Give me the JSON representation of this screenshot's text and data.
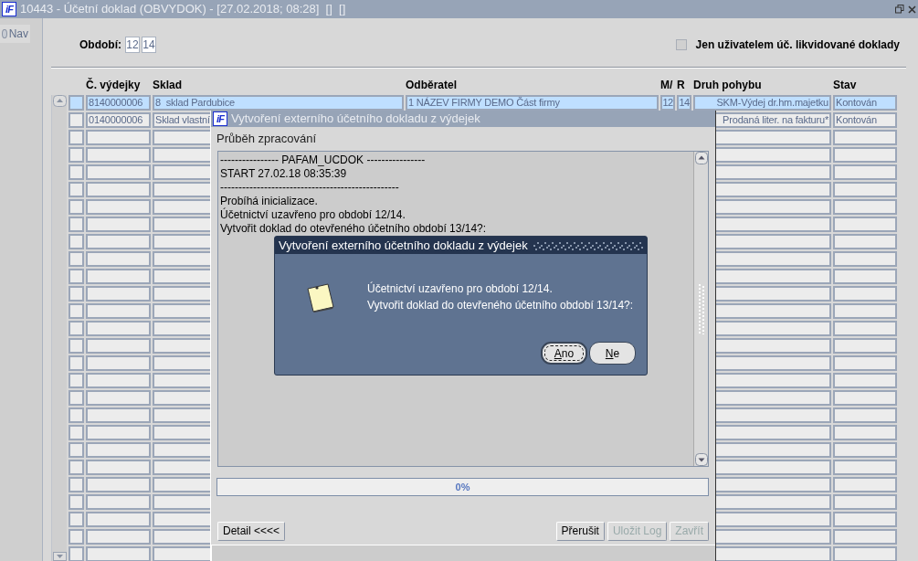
{
  "window": {
    "logo": "iF",
    "title": "10443 - Účetní doklad (OBVYDOK) - [27.02.2018; 08:28]  []  []"
  },
  "nav": {
    "label": "Nav",
    "selected": false
  },
  "filter": {
    "period_label": "Období:",
    "month": "12",
    "year": "14",
    "only_mine": {
      "label": "Jen uživatelem úč. likvidované doklady",
      "checked": false
    }
  },
  "table": {
    "columns": [
      "Č. výdejky",
      "Sklad",
      "Odběratel",
      "M/",
      "R",
      "Druh pohybu",
      "Stav"
    ],
    "rows": [
      {
        "selected": true,
        "cells": [
          "8140000006",
          "8  sklad Pardubice",
          "1 NÁZEV FIRMY DEMO Část firmy",
          "12",
          "14",
          "SKM-Výdej dr.hm.majetku",
          "Kontován"
        ]
      },
      {
        "selected": false,
        "cells": [
          "0140000006",
          "Sklad vlastní",
          null,
          null,
          null,
          "Prodaná liter. na fakturu*",
          "Kontován"
        ]
      }
    ]
  },
  "progress_window": {
    "logo": "iF",
    "title": "Vytvoření externího účetního dokladu z výdejek",
    "active": false,
    "section_label": "Průběh zpracování",
    "log": [
      "---------------- PAFAM_UCDOK ----------------",
      "START 27.02.18 08:35:39",
      "-------------------------------------------------",
      "Probíhá inicializace.",
      "Účetnictví uzavřeno pro období 12/14.",
      "Vytvořit doklad do otevřeného účetního období 13/14?:"
    ],
    "progress": {
      "level": 0,
      "text": "0%"
    },
    "detail_button": {
      "label": "Detail <<<<",
      "disabled": false
    },
    "buttons": [
      {
        "label": "Přerušit",
        "disabled": false
      },
      {
        "label": "Uložit Log",
        "disabled": true
      },
      {
        "label": "Zavřít",
        "disabled": true
      }
    ]
  },
  "question_dialog": {
    "title": "Vytvoření externího účetního dokladu z výdejek",
    "message": [
      "Účetnictví uzavřeno pro období 12/14.",
      "Vytvořit doklad do otevřeného účetního období 13/14?:"
    ],
    "buttons": [
      {
        "label": "Ano",
        "selected": true
      },
      {
        "label": "Ne",
        "selected": false
      }
    ]
  }
}
